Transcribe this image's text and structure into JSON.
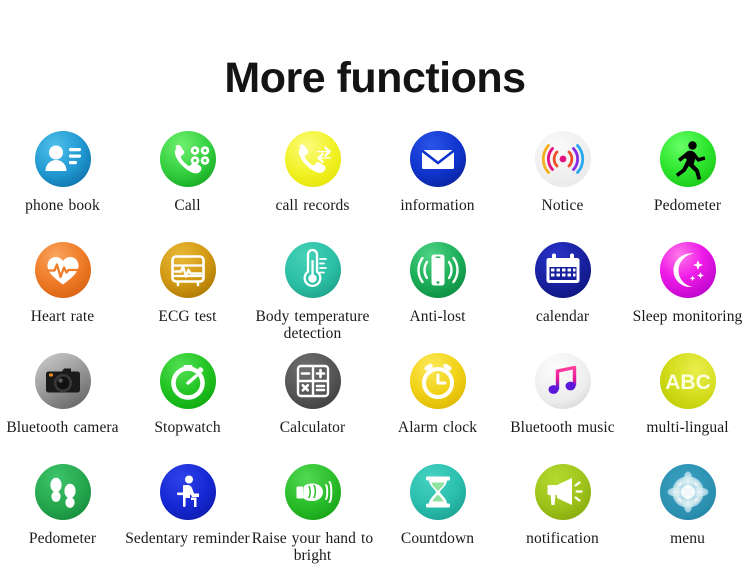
{
  "header": {
    "title": "More functions"
  },
  "grid": {
    "columns": 6,
    "rows": 4,
    "items": [
      {
        "label": "phone book",
        "icon": "contacts-icon",
        "color": "#2196d4"
      },
      {
        "label": "Call",
        "icon": "phone-dialpad-icon",
        "color": "#3fd13f"
      },
      {
        "label": "call records",
        "icon": "call-records-icon",
        "color": "#f2f228"
      },
      {
        "label": "information",
        "icon": "envelope-icon",
        "color": "#0f33cc"
      },
      {
        "label": "Notice",
        "icon": "notice-waves-icon",
        "color": "#f0f0f0"
      },
      {
        "label": "Pedometer",
        "icon": "running-man-icon",
        "color": "#2ee62e"
      },
      {
        "label": "Heart rate",
        "icon": "heart-pulse-icon",
        "color": "#ef7c28"
      },
      {
        "label": "ECG test",
        "icon": "ecg-monitor-icon",
        "color": "#d39a14"
      },
      {
        "label": "Body temperature detection",
        "icon": "thermometer-icon",
        "color": "#2bbfa5"
      },
      {
        "label": "Anti-lost",
        "icon": "phone-vibrate-icon",
        "color": "#1eb05a"
      },
      {
        "label": "calendar",
        "icon": "calendar-icon",
        "color": "#17209e"
      },
      {
        "label": "Sleep monitoring",
        "icon": "moon-stars-icon",
        "color": "#e616e6"
      },
      {
        "label": "Bluetooth camera",
        "icon": "camera-icon",
        "color": "#9c9c9c"
      },
      {
        "label": "Stopwatch",
        "icon": "stopwatch-icon",
        "color": "#22c422"
      },
      {
        "label": "Calculator",
        "icon": "calculator-icon",
        "color": "#555555"
      },
      {
        "label": "Alarm clock",
        "icon": "alarm-clock-icon",
        "color": "#f2d318"
      },
      {
        "label": "Bluetooth music",
        "icon": "music-note-icon",
        "color": "#ededed"
      },
      {
        "label": "multi-lingual",
        "icon": "abc-icon",
        "color": "#d4dd1e"
      },
      {
        "label": "Pedometer",
        "icon": "footprints-icon",
        "color": "#26a84f"
      },
      {
        "label": "Sedentary reminder",
        "icon": "sitting-person-icon",
        "color": "#1528d4"
      },
      {
        "label": "Raise your hand to bright",
        "icon": "raise-hand-icon",
        "color": "#2cbf2c"
      },
      {
        "label": "Countdown",
        "icon": "hourglass-icon",
        "color": "#2bbfae"
      },
      {
        "label": "notification",
        "icon": "megaphone-icon",
        "color": "#9ec41c"
      },
      {
        "label": "menu",
        "icon": "flower-menu-icon",
        "color": "#2b8fb0"
      }
    ]
  }
}
